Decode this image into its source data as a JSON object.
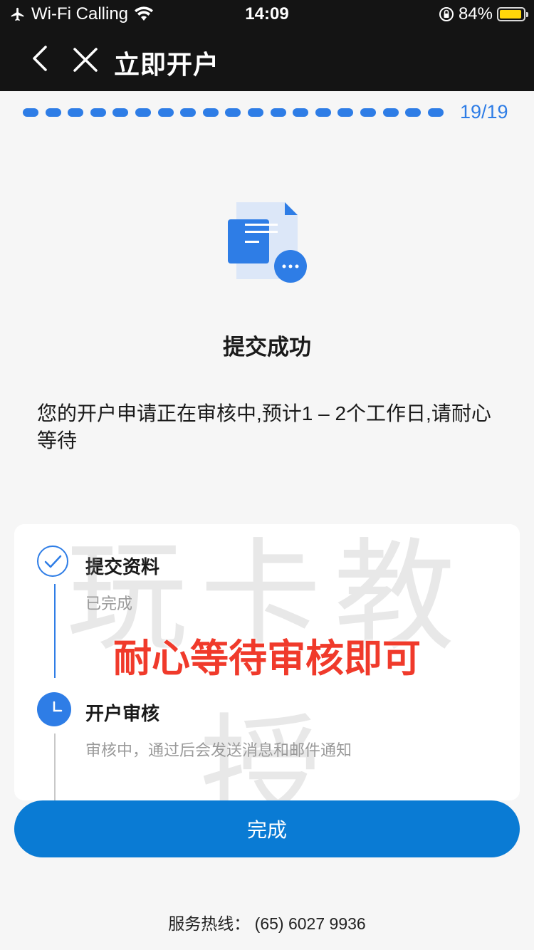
{
  "status_bar": {
    "carrier": "Wi-Fi Calling",
    "time": "14:09",
    "battery": "84%",
    "battery_color": "#ffd60a"
  },
  "nav": {
    "title": "立即开户",
    "back_icon": "chevron-left-icon",
    "close_icon": "close-icon"
  },
  "progress": {
    "count": "19/19",
    "current": 19,
    "total": 19,
    "accent": "#2e7de6"
  },
  "result": {
    "title": "提交成功",
    "description": "您的开户申请正在审核中,预计1 – 2个工作日,请耐心等待"
  },
  "steps": [
    {
      "title": "提交资料",
      "status": "已完成"
    },
    {
      "title": "开户审核",
      "status": "审核中，通过后会发送消息和邮件通知"
    }
  ],
  "watermark": "玩卡教授",
  "overlay_text": "耐心等待审核即可",
  "done_button": "完成",
  "hotline": "服务热线：  (65) 6027 9936"
}
